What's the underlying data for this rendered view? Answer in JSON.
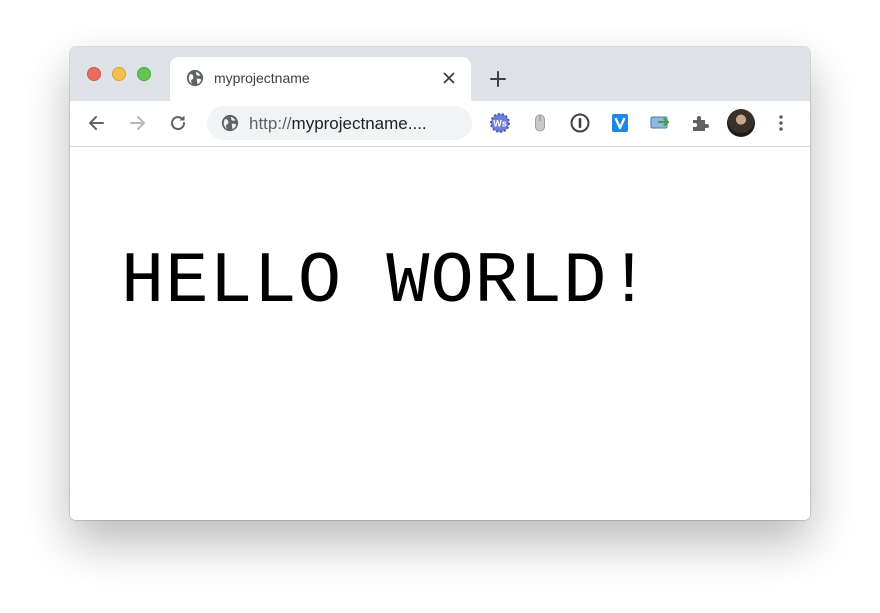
{
  "tab": {
    "title": "myprojectname",
    "favicon": "globe-icon"
  },
  "toolbar": {
    "back": "arrow-left-icon",
    "forward": "arrow-right-icon",
    "reload": "reload-icon"
  },
  "omnibox": {
    "scheme": "http://",
    "host": "myprojectname...."
  },
  "extensions": [
    "wappalyzer-icon",
    "mouse-icon",
    "1password-icon",
    "vimium-icon",
    "screen-share-icon",
    "extensions-puzzle-icon"
  ],
  "content": {
    "text": "HELLO WORLD!"
  },
  "colors": {
    "tabstrip": "#dee1e6",
    "omnibox": "#f1f3f4",
    "icon": "#5f6368",
    "close_light": "#ee6a5f",
    "minimize_light": "#f5be4f",
    "maximize_light": "#62c554"
  }
}
